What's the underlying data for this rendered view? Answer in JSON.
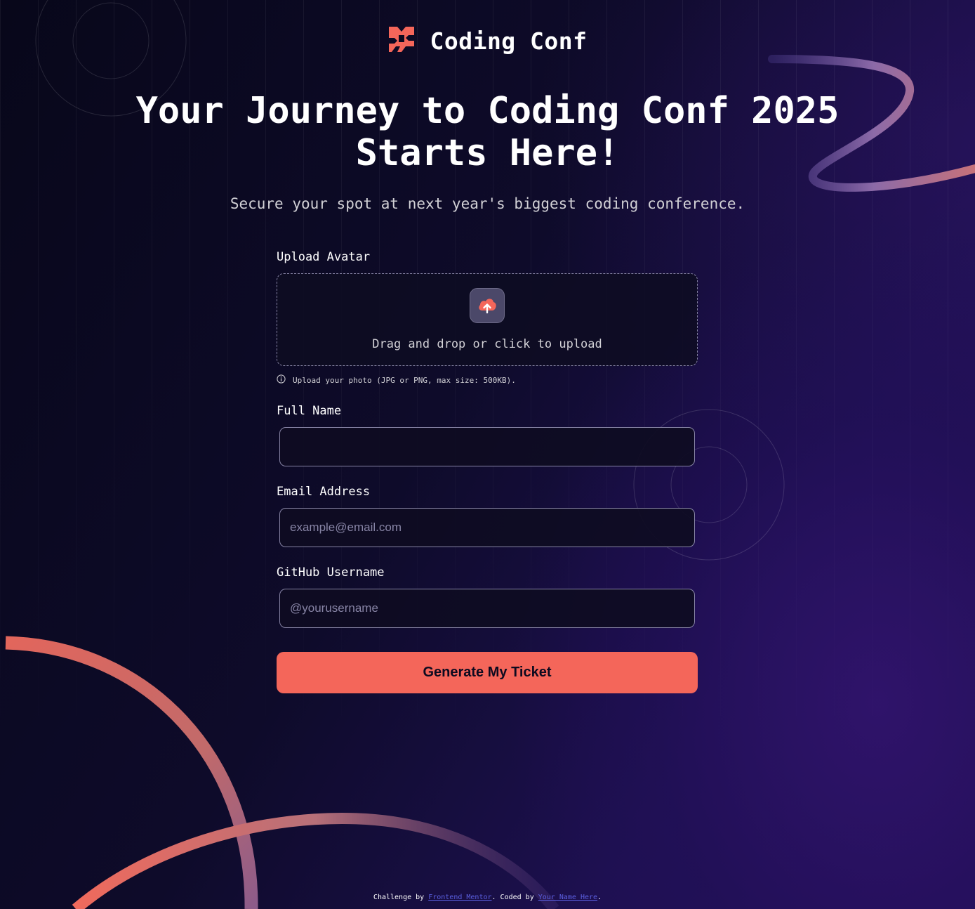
{
  "brand": {
    "name": "Coding Conf",
    "logo_icon": "coding-conf-logo-icon",
    "accent_color": "#f4665a"
  },
  "hero": {
    "title_line1": "Your Journey to Coding Conf 2025",
    "title_line2": "Starts Here!",
    "subtitle": "Secure your spot at next year's biggest coding conference."
  },
  "form": {
    "avatar": {
      "label": "Upload Avatar",
      "dropzone_text": "Drag and drop or click to upload",
      "hint": "Upload your photo (JPG or PNG, max size: 500KB).",
      "icon": "upload-cloud-icon",
      "hint_icon": "info-icon"
    },
    "full_name": {
      "label": "Full Name",
      "value": "",
      "placeholder": ""
    },
    "email": {
      "label": "Email Address",
      "value": "",
      "placeholder": "example@email.com"
    },
    "github": {
      "label": "GitHub Username",
      "value": "",
      "placeholder": "@yourusername"
    },
    "submit_label": "Generate My Ticket"
  },
  "footer": {
    "prefix": "Challenge by ",
    "challenge_link": "Frontend Mentor",
    "middle": ". Coded by ",
    "author_link": "Your Name Here",
    "suffix": "."
  }
}
